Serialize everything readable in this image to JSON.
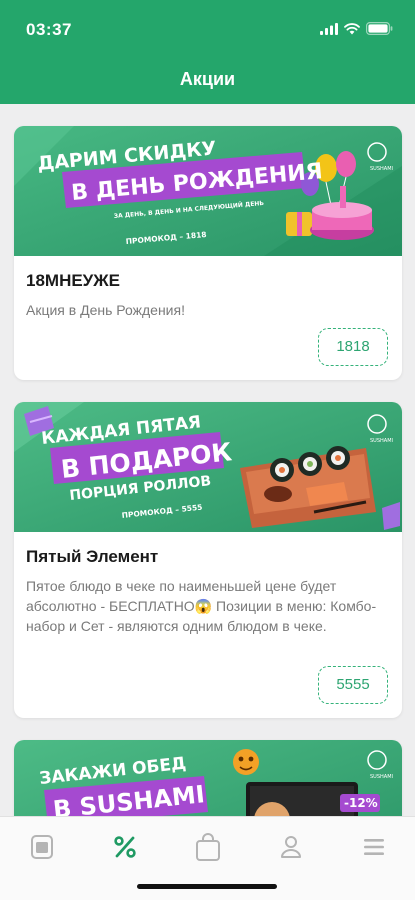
{
  "status_bar": {
    "time": "03:37"
  },
  "header": {
    "title": "Акции"
  },
  "promos": [
    {
      "title": "18МНЕУЖЕ",
      "description": "Акция в День Рождения!",
      "code": "1818",
      "banner": {
        "line1": "ДАРИМ СКИДКУ",
        "line2": "В ДЕНЬ РОЖДЕНИЯ",
        "line3": "ЗА ДЕНЬ, В ДЕНЬ И НА СЛЕДУЮЩИЙ ДЕНЬ",
        "promo": "ПРОМОКОД – 1818",
        "logo": "SUSHAMI"
      }
    },
    {
      "title": "Пятый Элемент",
      "description": "Пятое блюдо в чеке по наименьшей цене будет абсолютно - БЕСПЛАТНО😱 Позиции в меню: Комбо-набор и Сет - являются одним блюдом в чеке.",
      "code": "5555",
      "banner": {
        "line1": "КАЖДАЯ ПЯТАЯ",
        "line2": "В ПОДАРОК",
        "line3": "ПОРЦИЯ РОЛЛОВ",
        "promo": "ПРОМОКОД – 5555",
        "logo": "SUSHAMI"
      }
    },
    {
      "banner": {
        "line1": "ЗАКАЖИ ОБЕД",
        "line2": "В SUSHAMI",
        "badge": "-12%",
        "logo": "SUSHAMI"
      }
    }
  ],
  "tabs": [
    {
      "name": "menu",
      "icon": "menu-card-icon",
      "active": false
    },
    {
      "name": "promotions",
      "icon": "percent-icon",
      "active": true
    },
    {
      "name": "cart",
      "icon": "shopping-bag-icon",
      "active": false
    },
    {
      "name": "profile",
      "icon": "person-icon",
      "active": false
    },
    {
      "name": "more",
      "icon": "hamburger-icon",
      "active": false
    }
  ],
  "colors": {
    "brand_green": "#24a66b",
    "banner_purple": "#a54ad0",
    "active_tab": "#1f9a63",
    "inactive_tab": "#b4b4b4",
    "chip_text": "#2ea572"
  }
}
